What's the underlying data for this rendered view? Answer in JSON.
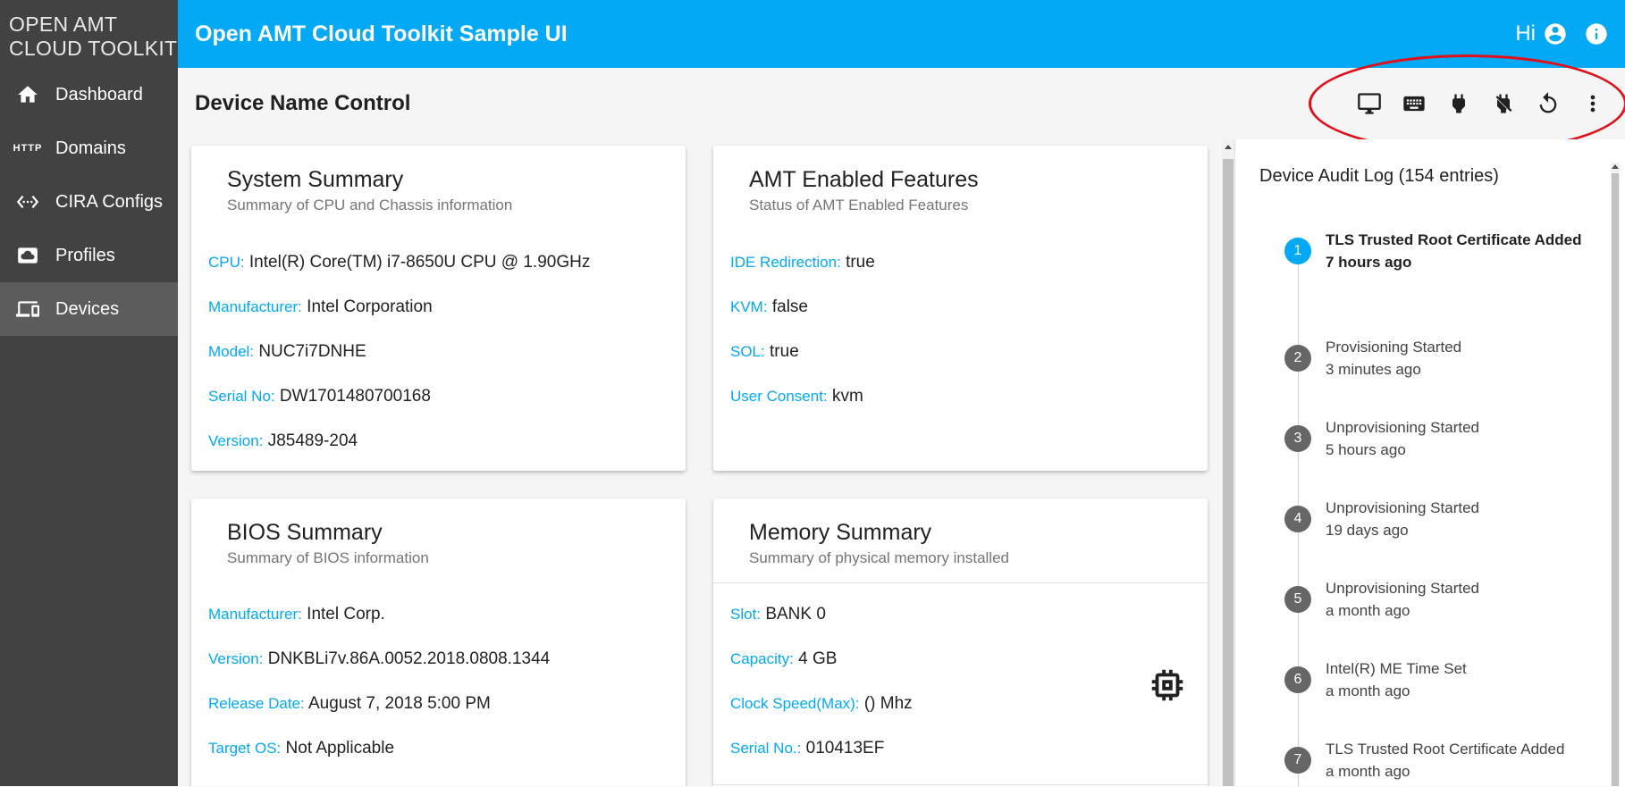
{
  "brand": {
    "line1": "OPEN AMT",
    "line2": "CLOUD TOOLKIT"
  },
  "nav": [
    {
      "label": "Dashboard",
      "icon": "home-icon"
    },
    {
      "label": "Domains",
      "icon": "http-icon",
      "icon_text": "HTTP"
    },
    {
      "label": "CIRA Configs",
      "icon": "settings-ethernet-icon"
    },
    {
      "label": "Profiles",
      "icon": "cloud-circle-icon"
    },
    {
      "label": "Devices",
      "icon": "devices-icon",
      "active": true
    }
  ],
  "topbar": {
    "title": "Open AMT Cloud Toolkit Sample UI",
    "greeting": "Hi"
  },
  "subheader": {
    "title": "Device Name Control",
    "actions": [
      "desktop-icon",
      "keyboard-icon",
      "power-plug-icon",
      "power-plug-off-icon",
      "restart-icon",
      "more-vert-icon"
    ]
  },
  "system_summary": {
    "title": "System Summary",
    "subtitle": "Summary of CPU and Chassis information",
    "fields": [
      {
        "label": "CPU:",
        "value": "Intel(R) Core(TM) i7-8650U CPU @ 1.90GHz"
      },
      {
        "label": "Manufacturer:",
        "value": "Intel Corporation"
      },
      {
        "label": "Model:",
        "value": "NUC7i7DNHE"
      },
      {
        "label": "Serial No:",
        "value": "DW1701480700168"
      },
      {
        "label": "Version:",
        "value": "J85489-204"
      }
    ]
  },
  "amt_features": {
    "title": "AMT Enabled Features",
    "subtitle": "Status of AMT Enabled Features",
    "fields": [
      {
        "label": "IDE Redirection:",
        "value": "true"
      },
      {
        "label": "KVM:",
        "value": "false"
      },
      {
        "label": "SOL:",
        "value": "true"
      },
      {
        "label": "User Consent:",
        "value": "kvm"
      }
    ]
  },
  "bios_summary": {
    "title": "BIOS Summary",
    "subtitle": "Summary of BIOS information",
    "fields": [
      {
        "label": "Manufacturer:",
        "value": "Intel Corp."
      },
      {
        "label": "Version:",
        "value": "DNKBLi7v.86A.0052.2018.0808.1344"
      },
      {
        "label": "Release Date:",
        "value": "August 7, 2018 5:00 PM"
      },
      {
        "label": "Target OS:",
        "value": "Not Applicable"
      }
    ]
  },
  "memory_summary": {
    "title": "Memory Summary",
    "subtitle": "Summary of physical memory installed",
    "fields": [
      {
        "label": "Slot:",
        "value": "BANK 0"
      },
      {
        "label": "Capacity:",
        "value": "4 GB"
      },
      {
        "label": "Clock Speed(Max):",
        "value": "() Mhz"
      },
      {
        "label": "Serial No.:",
        "value": "010413EF"
      }
    ],
    "icon": "memory-chip-icon"
  },
  "audit_log": {
    "title": "Device Audit Log (154 entries)",
    "entries": [
      {
        "num": "1",
        "event": "TLS Trusted Root Certificate Added",
        "time": "7 hours ago",
        "active": true
      },
      {
        "num": "2",
        "event": "Provisioning Started",
        "time": "3 minutes ago"
      },
      {
        "num": "3",
        "event": "Unprovisioning Started",
        "time": "5 hours ago"
      },
      {
        "num": "4",
        "event": "Unprovisioning Started",
        "time": "19 days ago"
      },
      {
        "num": "5",
        "event": "Unprovisioning Started",
        "time": "a month ago"
      },
      {
        "num": "6",
        "event": "Intel(R) ME Time Set",
        "time": "a month ago"
      },
      {
        "num": "7",
        "event": "TLS Trusted Root Certificate Added",
        "time": "a month ago"
      }
    ]
  },
  "colors": {
    "accent": "#03a9f4",
    "sidebar": "#424242",
    "highlight_oval": "#e0101a"
  }
}
